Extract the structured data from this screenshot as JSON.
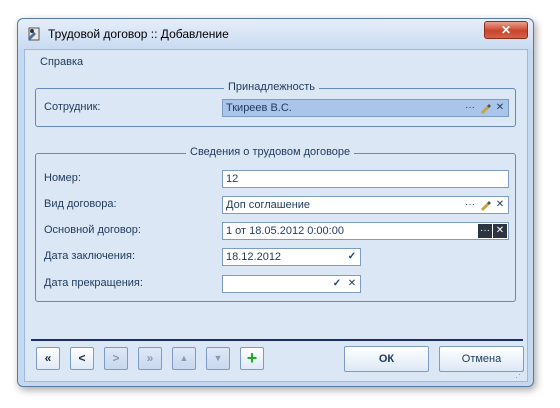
{
  "window": {
    "title": "Трудовой договор :: Добавление",
    "close_glyph": "✕"
  },
  "menu": {
    "help": "Справка"
  },
  "group1": {
    "legend": "Принадлежность",
    "employee_label": "Сотрудник:",
    "employee_value": "Ткиреев В.С."
  },
  "group2": {
    "legend": "Сведения о трудовом договоре",
    "number_label": "Номер:",
    "number_value": "12",
    "type_label": "Вид договора:",
    "type_value": "Доп соглашение",
    "main_label": "Основной договор:",
    "main_value": "1 от 18.05.2012 0:00:00",
    "date_start_label": "Дата заключения:",
    "date_start_value": "18.12.2012",
    "date_end_label": "Дата прекращения:",
    "date_end_value": ""
  },
  "nav": {
    "first": "«",
    "prev": "<",
    "next": ">",
    "last": "»",
    "up": "▲",
    "down": "▼",
    "add": "+"
  },
  "buttons": {
    "ok": "ОК",
    "cancel": "Отмена"
  },
  "glyphs": {
    "ellipsis": "···",
    "clear": "✕",
    "check": "✓"
  },
  "colors": {
    "accent": "#1b2e6b",
    "window_bg": "#c6d8f0",
    "selected_field": "#aac5ea",
    "close": "#c9452c"
  }
}
